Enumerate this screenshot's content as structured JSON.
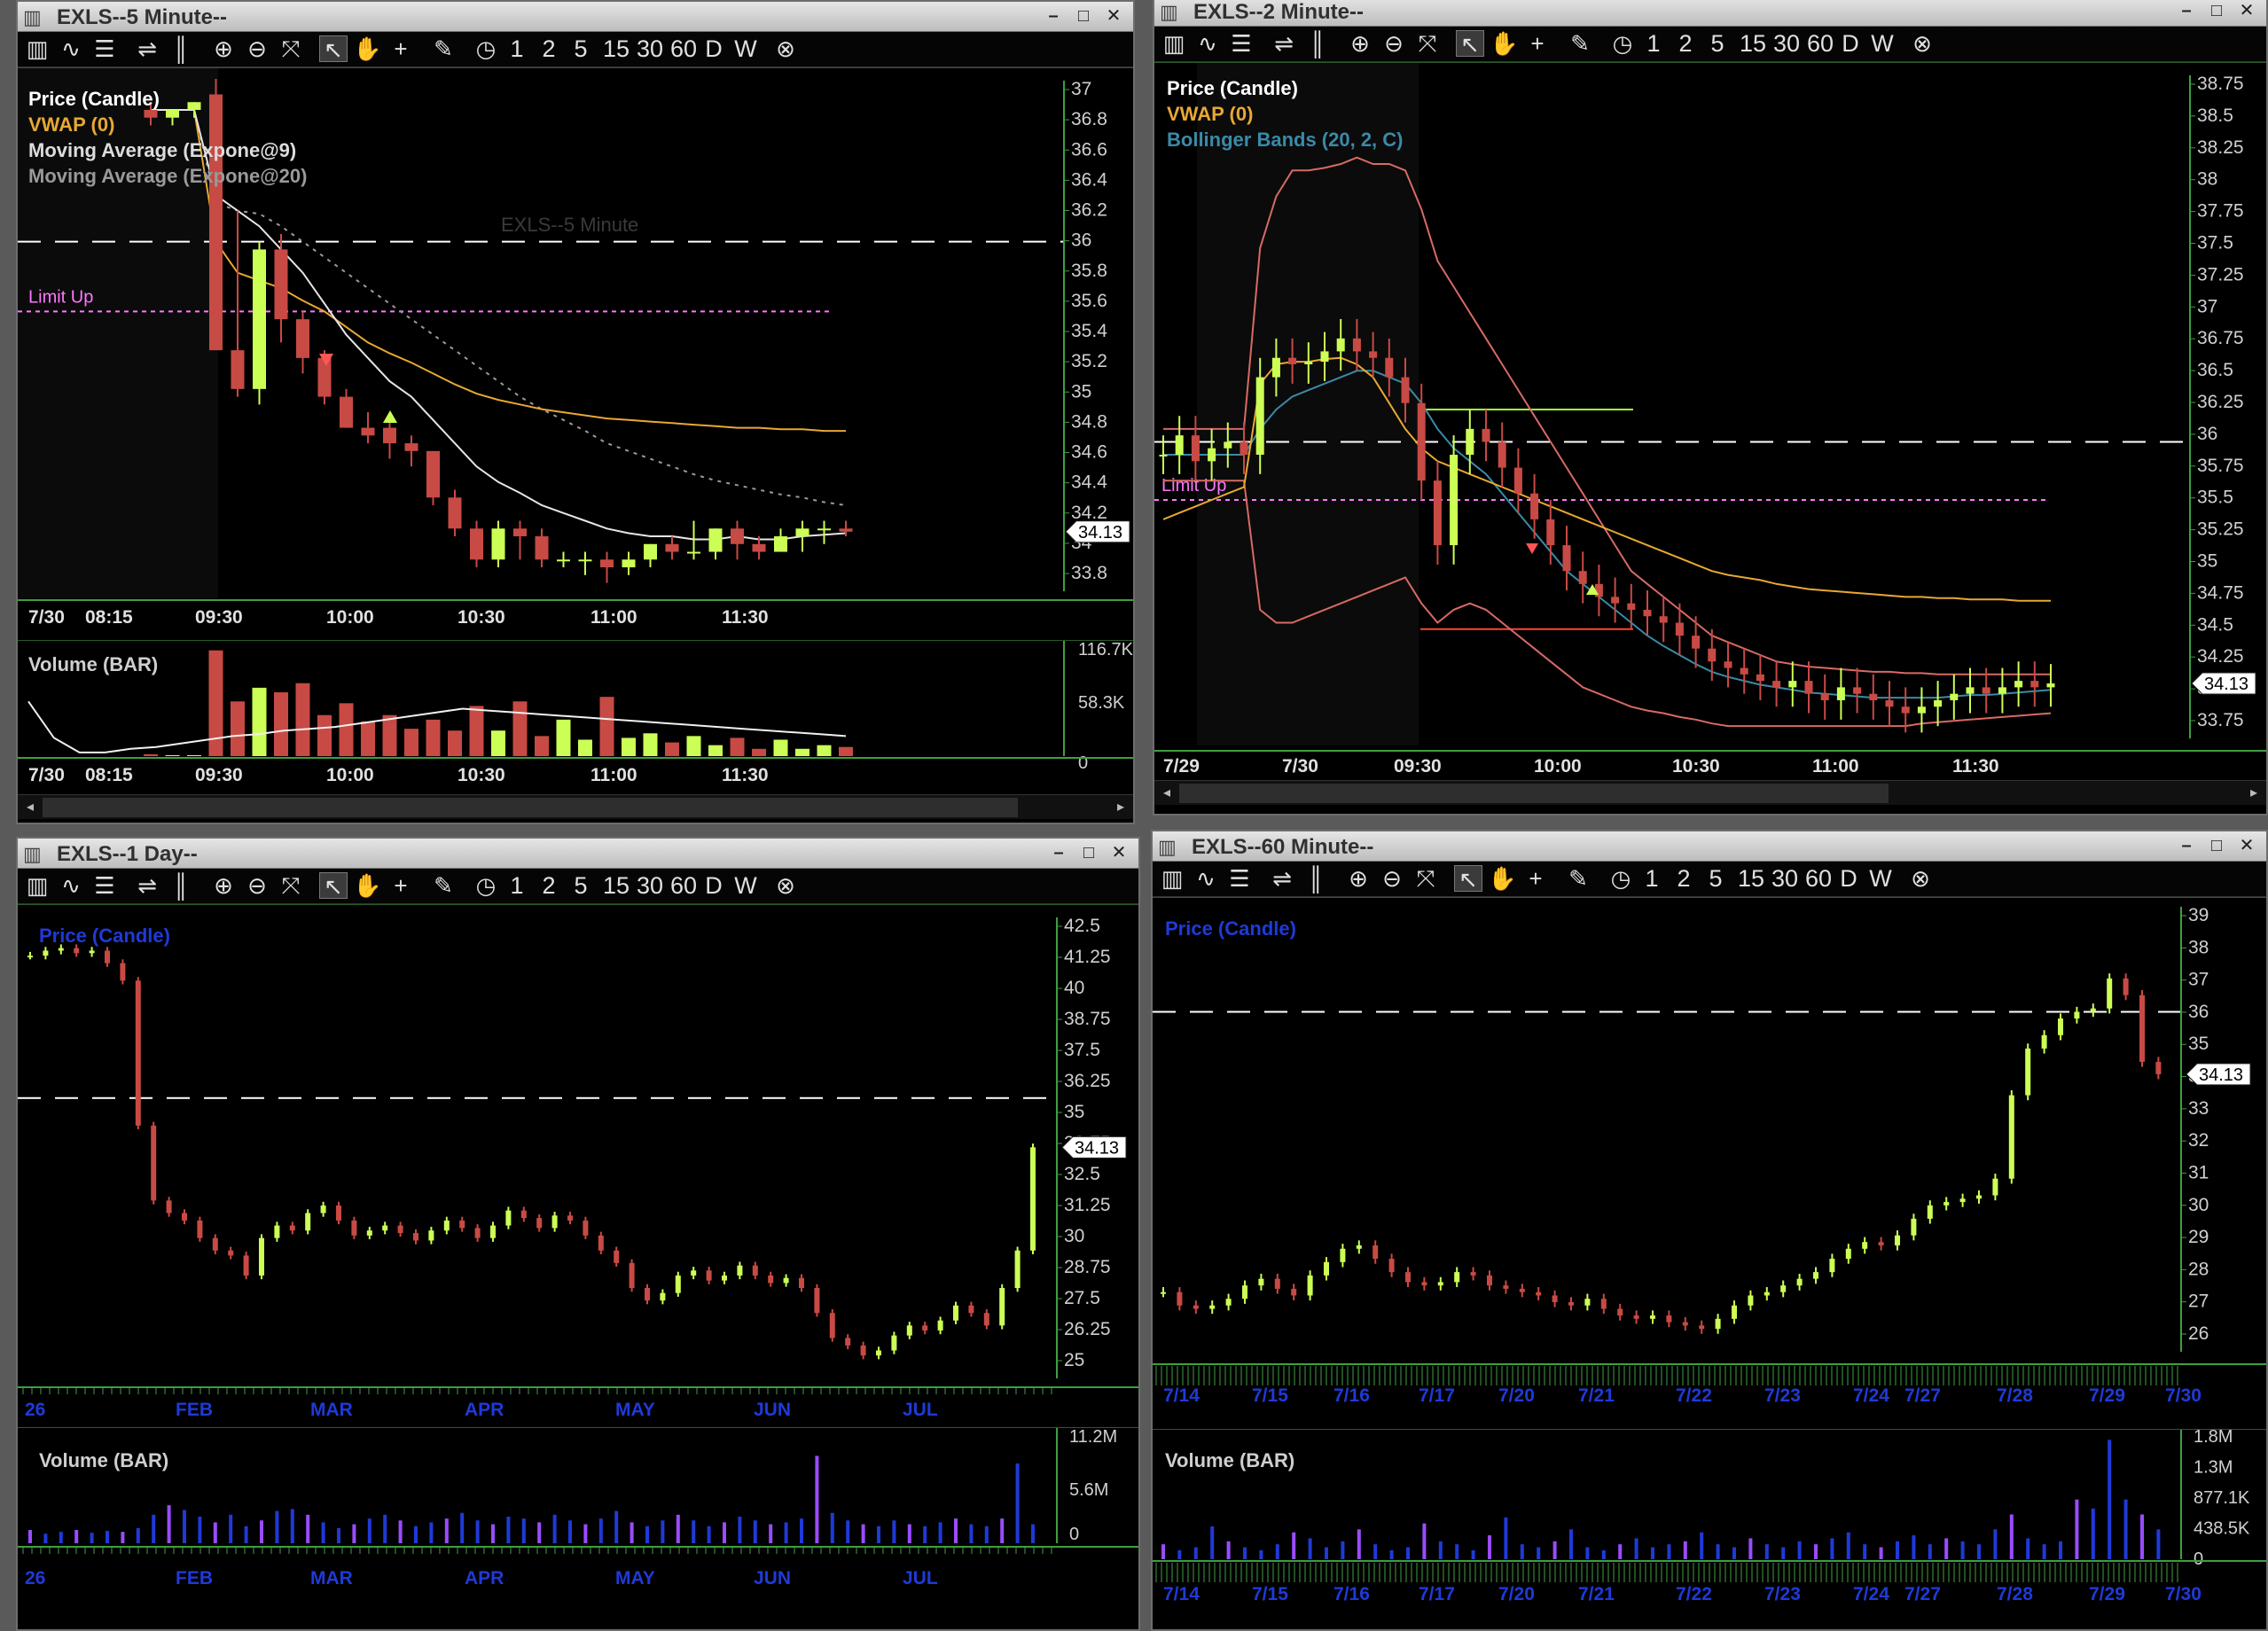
{
  "colors": {
    "up": "#ccff55",
    "down": "#c84a44",
    "vwap": "#e8a833",
    "axis_green": "#3f9f3f",
    "limit": "#ff77ff",
    "bb": "#d86a64",
    "bbmid": "#3a8aa8",
    "blue": "#1f3ad8",
    "purple": "#9a4cff"
  },
  "toolbar": {
    "icons": [
      "chart-type-icon",
      "indicator-icon",
      "style-icon",
      "lines-icon",
      "bars-icon",
      "zoom-in-icon",
      "zoom-out-icon",
      "auto-scale-icon",
      "pointer-icon",
      "hand-icon",
      "crosshair-icon",
      "draw-icon",
      "clock-icon"
    ],
    "intervals": [
      "1",
      "2",
      "5",
      "15",
      "30",
      "60",
      "D",
      "W"
    ],
    "close_symbol": "⊗"
  },
  "windows": {
    "w5": {
      "title": "EXLS--5 Minute--",
      "legend": [
        {
          "text": "Price (Candle)",
          "color": "#ffffff"
        },
        {
          "text": "VWAP (0)",
          "color": "#e8a833"
        },
        {
          "text": "Moving Average (Expone@9)",
          "color": "#dcdcdc"
        },
        {
          "text": "Moving Average (Expone@20)",
          "color": "#9a9a9a"
        }
      ],
      "watermark": "EXLS--5 Minute",
      "limit_label": "Limit Up",
      "price_axis": [
        "37",
        "36.8",
        "36.6",
        "36.4",
        "36.2",
        "36",
        "35.8",
        "35.6",
        "35.4",
        "35.2",
        "35",
        "34.8",
        "34.6",
        "34.4",
        "34.2",
        "34",
        "33.8"
      ],
      "last_price": "34.13",
      "time_axis": [
        "7/30",
        "08:15",
        "09:30",
        "10:00",
        "10:30",
        "11:00",
        "11:30"
      ],
      "volume_label": "Volume (BAR)",
      "volume_axis": [
        "116.7K",
        "58.3K",
        "0"
      ],
      "volume_time_axis": [
        "7/30",
        "08:15",
        "09:30",
        "10:00",
        "10:30",
        "11:00",
        "11:30"
      ]
    },
    "w2": {
      "title": "EXLS--2 Minute--",
      "legend": [
        {
          "text": "Price (Candle)",
          "color": "#ffffff"
        },
        {
          "text": "VWAP (0)",
          "color": "#e8a833"
        },
        {
          "text": "Bollinger Bands (20, 2, C)",
          "color": "#3a8aa8"
        }
      ],
      "limit_label": "Limit Up",
      "price_axis": [
        "38.75",
        "38.5",
        "38.25",
        "38",
        "37.75",
        "37.5",
        "37.25",
        "37",
        "36.75",
        "36.5",
        "36.25",
        "36",
        "35.75",
        "35.5",
        "35.25",
        "35",
        "34.75",
        "34.5",
        "34.25",
        "34",
        "33.75"
      ],
      "last_price": "34.13",
      "time_axis": [
        "7/29",
        "7/30",
        "09:30",
        "10:00",
        "10:30",
        "11:00",
        "11:30"
      ]
    },
    "wd": {
      "title": "EXLS--1 Day--",
      "legend": [
        {
          "text": "Price (Candle)",
          "color": "#1f3ad8"
        }
      ],
      "price_axis": [
        "42.5",
        "41.25",
        "40",
        "38.75",
        "37.5",
        "36.25",
        "35",
        "33.75",
        "32.5",
        "31.25",
        "30",
        "28.75",
        "27.5",
        "26.25",
        "25"
      ],
      "last_price": "34.13",
      "time_axis": [
        "26",
        "FEB",
        "MAR",
        "APR",
        "MAY",
        "JUN",
        "JUL"
      ],
      "volume_label": "Volume (BAR)",
      "volume_axis": [
        "11.2M",
        "5.6M",
        "0"
      ],
      "volume_time_axis": [
        "26",
        "FEB",
        "MAR",
        "APR",
        "MAY",
        "JUN",
        "JUL"
      ]
    },
    "w60": {
      "title": "EXLS--60 Minute--",
      "legend": [
        {
          "text": "Price (Candle)",
          "color": "#1f3ad8"
        }
      ],
      "price_axis": [
        "39",
        "38",
        "37",
        "36",
        "35",
        "34",
        "33",
        "32",
        "31",
        "30",
        "29",
        "28",
        "27",
        "26"
      ],
      "last_price": "34.13",
      "time_axis": [
        "7/14",
        "7/15",
        "7/16",
        "7/17",
        "7/20",
        "7/21",
        "7/22",
        "7/23",
        "7/24",
        "7/27",
        "7/28",
        "7/29",
        "7/30"
      ],
      "volume_label": "Volume (BAR)",
      "volume_axis": [
        "1.8M",
        "1.3M",
        "877.1K",
        "438.5K",
        "0"
      ],
      "volume_time_axis": [
        "7/14",
        "7/15",
        "7/16",
        "7/17",
        "7/20",
        "7/21",
        "7/22",
        "7/23",
        "7/24",
        "7/27",
        "7/28",
        "7/29",
        "7/30"
      ]
    }
  },
  "chart_data": [
    {
      "chart": "EXLS 5 Minute",
      "type": "candlestick",
      "y_range": [
        33.7,
        37.05
      ],
      "reference_lines": [
        {
          "name": "dashed",
          "y": 36.0
        },
        {
          "name": "Limit Up",
          "y": 35.55
        }
      ],
      "x": [
        "09:15",
        "09:20",
        "09:25",
        "09:30",
        "09:35",
        "09:40",
        "09:45",
        "09:50",
        "09:55",
        "10:00",
        "10:05",
        "10:10",
        "10:15",
        "10:20",
        "10:25",
        "10:30",
        "10:35",
        "10:40",
        "10:45",
        "10:50",
        "10:55",
        "11:00",
        "11:05",
        "11:10",
        "11:15",
        "11:20",
        "11:25",
        "11:30",
        "11:35",
        "11:40",
        "11:45",
        "11:50",
        "11:55"
      ],
      "open": [
        36.85,
        36.8,
        36.85,
        36.95,
        35.3,
        35.05,
        35.95,
        35.5,
        35.25,
        35.0,
        34.8,
        34.8,
        34.7,
        34.65,
        34.35,
        34.15,
        33.95,
        34.15,
        34.1,
        33.95,
        33.95,
        33.95,
        33.9,
        33.95,
        34.05,
        34.0,
        34.0,
        34.15,
        34.05,
        34.0,
        34.1,
        34.15,
        34.15
      ],
      "high": [
        36.9,
        36.85,
        36.9,
        37.05,
        36.2,
        36.0,
        36.05,
        35.55,
        35.3,
        35.05,
        34.9,
        34.85,
        34.75,
        34.65,
        34.4,
        34.2,
        34.2,
        34.2,
        34.15,
        34.0,
        34.0,
        34.0,
        34.0,
        34.05,
        34.1,
        34.2,
        34.15,
        34.2,
        34.1,
        34.15,
        34.2,
        34.2,
        34.2
      ],
      "low": [
        36.75,
        36.75,
        36.8,
        35.5,
        35.0,
        34.95,
        35.35,
        35.15,
        34.95,
        34.8,
        34.7,
        34.6,
        34.55,
        34.3,
        34.1,
        33.9,
        33.9,
        33.95,
        33.9,
        33.9,
        33.85,
        33.8,
        33.85,
        33.9,
        33.95,
        33.95,
        33.95,
        33.95,
        33.95,
        34.0,
        34.0,
        34.05,
        34.1
      ],
      "close": [
        36.8,
        36.85,
        36.9,
        35.3,
        35.05,
        35.95,
        35.5,
        35.25,
        35.0,
        34.8,
        34.75,
        34.7,
        34.65,
        34.35,
        34.15,
        33.95,
        34.15,
        34.1,
        33.95,
        33.95,
        33.95,
        33.9,
        33.95,
        34.05,
        34.0,
        34.0,
        34.15,
        34.05,
        34.0,
        34.1,
        34.15,
        34.15,
        34.13
      ],
      "vwap": [
        36.85,
        36.85,
        36.85,
        36.0,
        35.8,
        35.75,
        35.7,
        35.62,
        35.55,
        35.45,
        35.35,
        35.28,
        35.22,
        35.15,
        35.08,
        35.02,
        34.98,
        34.95,
        34.92,
        34.9,
        34.88,
        34.86,
        34.85,
        34.84,
        34.83,
        34.82,
        34.81,
        34.8,
        34.8,
        34.79,
        34.79,
        34.78,
        34.78
      ],
      "ema9": [
        36.85,
        36.85,
        36.85,
        36.3,
        36.2,
        36.1,
        35.95,
        35.8,
        35.6,
        35.4,
        35.25,
        35.1,
        35.0,
        34.85,
        34.7,
        34.55,
        34.45,
        34.38,
        34.3,
        34.25,
        34.2,
        34.15,
        34.12,
        34.1,
        34.1,
        34.08,
        34.08,
        34.1,
        34.08,
        34.08,
        34.1,
        34.11,
        34.12
      ],
      "ema20": [
        36.85,
        36.85,
        36.85,
        36.25,
        36.2,
        36.18,
        36.1,
        36.0,
        35.9,
        35.8,
        35.7,
        35.6,
        35.5,
        35.4,
        35.3,
        35.2,
        35.1,
        35.0,
        34.92,
        34.85,
        34.78,
        34.7,
        34.65,
        34.6,
        34.55,
        34.5,
        34.46,
        34.43,
        34.4,
        34.37,
        34.35,
        34.32,
        34.3
      ],
      "volume": [
        2,
        1,
        1,
        116,
        60,
        75,
        70,
        80,
        45,
        58,
        38,
        45,
        30,
        40,
        28,
        55,
        28,
        60,
        22,
        40,
        18,
        65,
        20,
        25,
        15,
        22,
        12,
        20,
        8,
        18,
        8,
        12,
        10
      ]
    },
    {
      "chart": "EXLS 2 Minute",
      "type": "candlestick",
      "y_range": [
        33.65,
        38.85
      ],
      "reference_lines": [
        {
          "name": "dashed",
          "y": 36.0
        },
        {
          "name": "Limit Up",
          "y": 35.55
        }
      ],
      "close": [
        35.9,
        36.05,
        35.85,
        35.95,
        36.0,
        35.9,
        36.5,
        36.65,
        36.6,
        36.62,
        36.7,
        36.8,
        36.7,
        36.65,
        36.5,
        36.3,
        35.7,
        35.2,
        35.9,
        36.1,
        36.0,
        35.8,
        35.6,
        35.4,
        35.2,
        35.0,
        34.9,
        34.8,
        34.75,
        34.7,
        34.65,
        34.6,
        34.5,
        34.4,
        34.3,
        34.25,
        34.2,
        34.15,
        34.1,
        34.15,
        34.05,
        34.0,
        34.1,
        34.05,
        34.0,
        33.95,
        33.9,
        33.95,
        34.0,
        34.05,
        34.1,
        34.05,
        34.1,
        34.15,
        34.1,
        34.13
      ],
      "vwap": [
        35.4,
        35.45,
        35.5,
        35.55,
        35.6,
        35.65,
        36.45,
        36.6,
        36.62,
        36.62,
        36.64,
        36.65,
        36.6,
        36.5,
        36.3,
        36.1,
        35.95,
        35.85,
        35.8,
        35.75,
        35.7,
        35.65,
        35.6,
        35.55,
        35.5,
        35.45,
        35.4,
        35.35,
        35.3,
        35.25,
        35.2,
        35.15,
        35.1,
        35.05,
        35.0,
        34.97,
        34.95,
        34.93,
        34.9,
        34.88,
        34.86,
        34.85,
        34.84,
        34.83,
        34.82,
        34.81,
        34.8,
        34.8,
        34.79,
        34.79,
        34.78,
        34.78,
        34.78,
        34.77,
        34.77,
        34.77
      ],
      "bb_upper": [
        36.1,
        36.1,
        36.1,
        36.1,
        36.1,
        36.1,
        37.5,
        37.9,
        38.1,
        38.1,
        38.12,
        38.15,
        38.2,
        38.15,
        38.15,
        38.1,
        37.8,
        37.4,
        37.2,
        37.0,
        36.8,
        36.6,
        36.4,
        36.2,
        36.0,
        35.8,
        35.6,
        35.4,
        35.2,
        35.0,
        34.9,
        34.8,
        34.7,
        34.6,
        34.5,
        34.45,
        34.4,
        34.35,
        34.3,
        34.28,
        34.26,
        34.25,
        34.24,
        34.23,
        34.22,
        34.22,
        34.21,
        34.21,
        34.2,
        34.2,
        34.2,
        34.2,
        34.2,
        34.2,
        34.2,
        34.2
      ],
      "bb_lower": [
        35.7,
        35.7,
        35.7,
        35.7,
        35.7,
        35.7,
        34.7,
        34.6,
        34.6,
        34.65,
        34.7,
        34.75,
        34.8,
        34.85,
        34.9,
        34.95,
        34.75,
        34.6,
        34.7,
        34.75,
        34.7,
        34.6,
        34.5,
        34.4,
        34.3,
        34.2,
        34.1,
        34.05,
        34.0,
        33.95,
        33.92,
        33.9,
        33.87,
        33.85,
        33.82,
        33.8,
        33.8,
        33.8,
        33.8,
        33.8,
        33.8,
        33.8,
        33.8,
        33.8,
        33.8,
        33.8,
        33.8,
        33.82,
        33.83,
        33.84,
        33.85,
        33.86,
        33.87,
        33.88,
        33.89,
        33.9
      ],
      "bb_mid": [
        35.9,
        35.9,
        35.9,
        35.9,
        35.9,
        35.9,
        36.1,
        36.25,
        36.35,
        36.4,
        36.45,
        36.5,
        36.55,
        36.55,
        36.5,
        36.45,
        36.3,
        36.1,
        35.95,
        35.85,
        35.75,
        35.6,
        35.45,
        35.3,
        35.15,
        35.0,
        34.9,
        34.8,
        34.7,
        34.6,
        34.5,
        34.42,
        34.35,
        34.28,
        34.22,
        34.18,
        34.15,
        34.12,
        34.1,
        34.08,
        34.06,
        34.05,
        34.04,
        34.03,
        34.02,
        34.02,
        34.02,
        34.02,
        34.02,
        34.03,
        34.04,
        34.04,
        34.05,
        34.06,
        34.07,
        34.08
      ]
    },
    {
      "chart": "EXLS 1 Day",
      "type": "candlestick",
      "y_range": [
        24.6,
        43.4
      ],
      "reference_lines": [
        {
          "name": "dashed",
          "y": 36.1
        }
      ],
      "close": [
        41.8,
        42.0,
        42.1,
        41.9,
        42.0,
        41.5,
        40.8,
        35.0,
        32.0,
        31.5,
        31.2,
        30.5,
        30.0,
        29.8,
        29.0,
        30.5,
        31.0,
        30.8,
        31.5,
        31.8,
        31.2,
        30.6,
        30.8,
        31.0,
        30.7,
        30.4,
        30.8,
        31.2,
        30.9,
        30.5,
        31.0,
        31.6,
        31.3,
        30.9,
        31.4,
        31.2,
        30.6,
        30.0,
        29.5,
        28.5,
        28.0,
        28.3,
        29.0,
        29.2,
        28.8,
        29.0,
        29.4,
        29.0,
        28.7,
        28.9,
        28.5,
        27.5,
        26.5,
        26.2,
        25.8,
        26.0,
        26.6,
        27.0,
        26.8,
        27.2,
        27.8,
        27.5,
        27.0,
        28.5,
        30.0,
        34.13
      ]
    },
    {
      "chart": "EXLS 60 Minute",
      "type": "candlestick",
      "y_range": [
        25.6,
        39.2
      ],
      "reference_lines": [
        {
          "name": "dashed",
          "y": 36.0
        }
      ],
      "close": [
        27.6,
        27.2,
        27.1,
        27.2,
        27.4,
        27.8,
        28.0,
        27.7,
        27.5,
        28.1,
        28.5,
        28.9,
        29.0,
        28.6,
        28.2,
        27.9,
        27.8,
        27.9,
        28.2,
        28.1,
        27.8,
        27.7,
        27.6,
        27.5,
        27.3,
        27.2,
        27.4,
        27.1,
        26.9,
        26.8,
        26.9,
        26.7,
        26.6,
        26.5,
        26.8,
        27.2,
        27.5,
        27.6,
        27.8,
        28.0,
        28.2,
        28.6,
        28.9,
        29.1,
        29.0,
        29.3,
        29.8,
        30.2,
        30.3,
        30.4,
        30.5,
        31.0,
        33.5,
        34.9,
        35.3,
        35.8,
        36.0,
        36.1,
        37.0,
        36.5,
        34.5,
        34.13
      ]
    }
  ]
}
